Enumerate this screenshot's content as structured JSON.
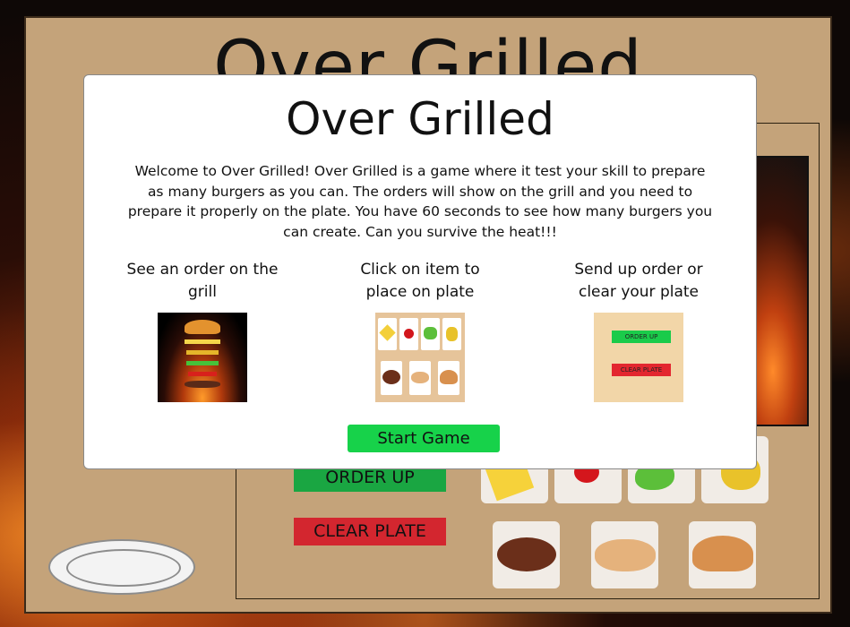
{
  "game_title": "Over Grilled",
  "buttons": {
    "order_up": "ORDER UP",
    "clear_plate": "CLEAR PLATE"
  },
  "modal": {
    "title": "Over Grilled",
    "description": "Welcome to Over Grilled! Over Grilled is a game where it test your skill to prepare as many burgers as you can. The orders will show on the grill and you need to prepare it properly on the plate. You have 60 seconds to see how many burgers you can create. Can you survive the heat!!!",
    "steps": [
      {
        "label": "See an order on the grill",
        "icon": "burger-stack-image"
      },
      {
        "label": "Click on item to place on plate",
        "icon": "ingredients-image"
      },
      {
        "label": "Send up order or clear your plate",
        "icon": "buttons-image"
      }
    ],
    "step_image_text": {
      "order_up": "ORDER UP",
      "clear_plate": "CLEAR PLATE"
    },
    "start_button": "Start Game"
  },
  "ingredients": [
    "cheese",
    "ketchup",
    "lettuce",
    "pickles",
    "patty",
    "bottom-bun",
    "top-bun"
  ],
  "colors": {
    "board": "#c4a37a",
    "order_green": "#1aa642",
    "clear_red": "#d3262f",
    "start_green": "#17d24a"
  }
}
